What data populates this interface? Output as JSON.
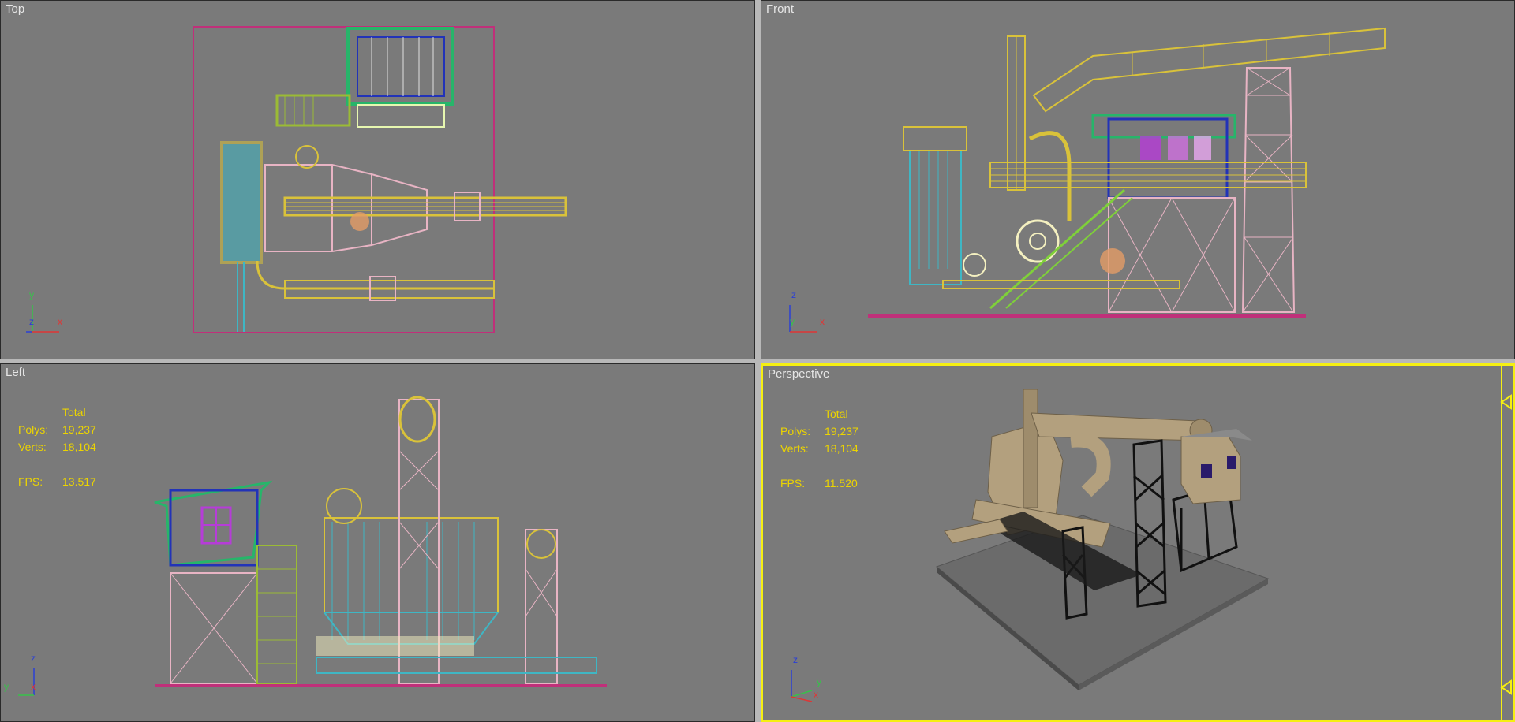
{
  "viewports": {
    "top": {
      "label": "Top",
      "axes": {
        "y": "y",
        "z": "z",
        "x": "x"
      }
    },
    "front": {
      "label": "Front",
      "axes": {
        "z": "z",
        "y": "y",
        "x": "x"
      }
    },
    "left": {
      "label": "Left",
      "stats": {
        "header": "Total",
        "polys_label": "Polys:",
        "polys": "19,237",
        "verts_label": "Verts:",
        "verts": "18,104",
        "fps_label": "FPS:",
        "fps": "13.517"
      },
      "axes": {
        "z": "z",
        "y": "y",
        "x": "x"
      }
    },
    "perspective": {
      "label": "Perspective",
      "stats": {
        "header": "Total",
        "polys_label": "Polys:",
        "polys": "19,237",
        "verts_label": "Verts:",
        "verts": "18,104",
        "fps_label": "FPS:",
        "fps": "11.520"
      },
      "axes": {
        "z": "z",
        "y": "y",
        "x": "x"
      },
      "active": true
    }
  },
  "colors": {
    "viewport_bg": "#7a7a7a",
    "active_border": "#f5ef12",
    "stats_text": "#ecd400",
    "wire_yellow": "#d9c23a",
    "wire_pink": "#e8b4c4",
    "wire_cyan": "#3fb6c4",
    "wire_green": "#7fd03a",
    "wire_blue": "#2233b8",
    "wire_magenta": "#c0307a",
    "wire_purple": "#b63cd8"
  }
}
